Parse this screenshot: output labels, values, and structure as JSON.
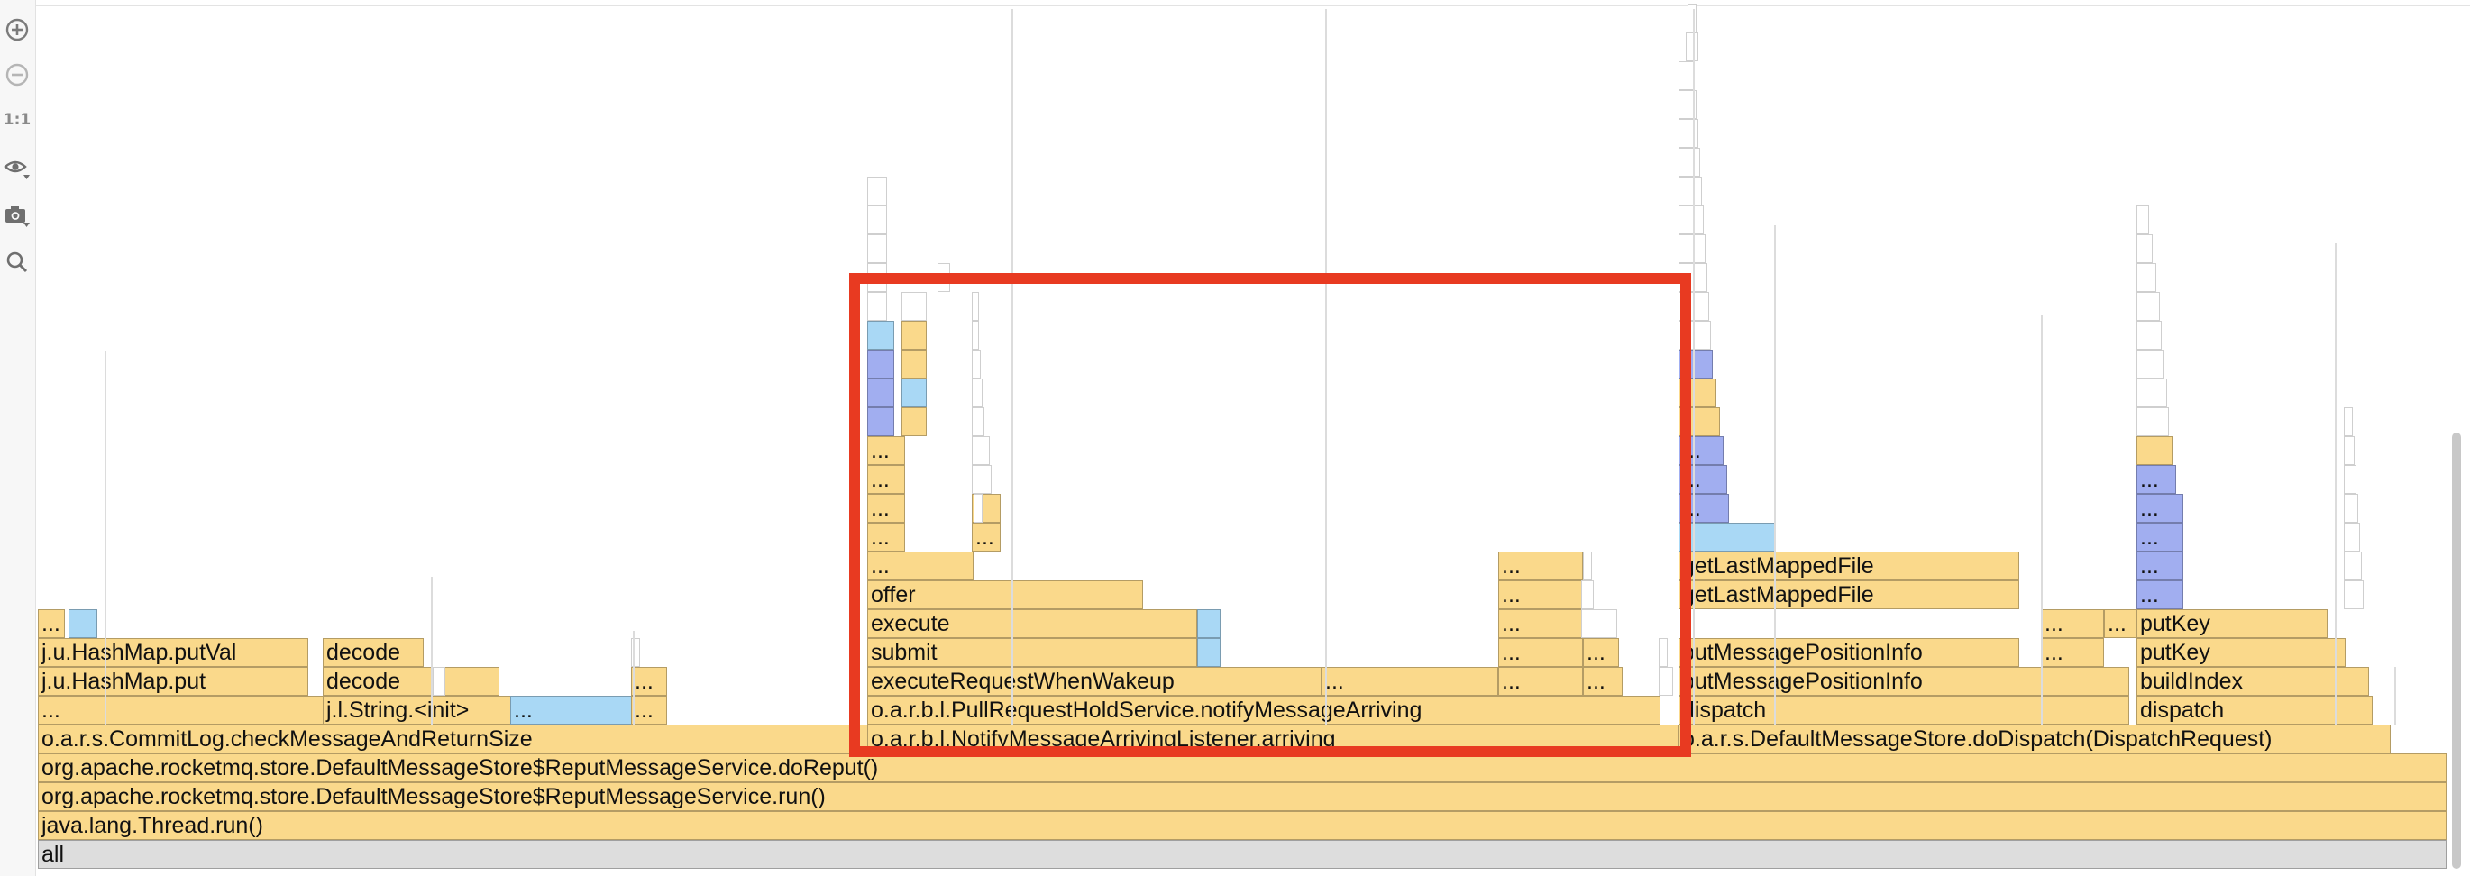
{
  "toolbar": {
    "zoom_in_icon": "zoom-in-icon",
    "zoom_out_icon": "zoom-out-icon",
    "reset_scale_label": "1:1",
    "view_icon": "eye-icon",
    "screenshot_icon": "camera-icon",
    "search_icon": "search-icon"
  },
  "colors": {
    "frame_yellow": "#fad98b",
    "frame_light_blue": "#a9d8f5",
    "frame_blue": "#a1aef0",
    "frame_gray": "#dddddd",
    "frame_empty": "#ffffff",
    "highlight_red": "#e83a21"
  },
  "frames": [
    {
      "label": "all",
      "c": "g"
    },
    {
      "label": "java.lang.Thread.run()",
      "c": "y"
    },
    {
      "label": "org.apache.rocketmq.store.DefaultMessageStore$ReputMessageService.run()",
      "c": "y"
    },
    {
      "label": "org.apache.rocketmq.store.DefaultMessageStore$ReputMessageService.doReput()",
      "c": "y"
    },
    {
      "label": "o.a.r.s.CommitLog.checkMessageAndReturnSize",
      "c": "y"
    },
    {
      "label": "o.a.r.b.l.NotifyMessageArrivingListener.arriving",
      "c": "y"
    },
    {
      "label": "o.a.r.s.DefaultMessageStore.doDispatch(DispatchRequest)",
      "c": "y"
    },
    {
      "label": "...",
      "c": "y"
    },
    {
      "label": "j.l.String.<init>",
      "c": "y"
    },
    {
      "label": "...",
      "c": "b"
    },
    {
      "label": "...",
      "c": "y"
    },
    {
      "label": "o.a.r.b.l.PullRequestHoldService.notifyMessageArriving",
      "c": "y"
    },
    {
      "label": "dispatch",
      "c": "y"
    },
    {
      "label": "dispatch",
      "c": "y"
    },
    {
      "label": "j.u.HashMap.put",
      "c": "y"
    },
    {
      "label": "decode",
      "c": "y"
    },
    {
      "label": "...",
      "c": "y"
    },
    {
      "label": "executeRequestWhenWakeup",
      "c": "y"
    },
    {
      "label": "...",
      "c": "y"
    },
    {
      "label": "...",
      "c": "y"
    },
    {
      "label": "...",
      "c": "y"
    },
    {
      "label": "putMessagePositionInfo",
      "c": "y"
    },
    {
      "label": "buildIndex",
      "c": "y"
    },
    {
      "label": "j.u.HashMap.putVal",
      "c": "y"
    },
    {
      "label": "decode",
      "c": "y"
    },
    {
      "label": "submit",
      "c": "y"
    },
    {
      "label": "",
      "c": "b"
    },
    {
      "label": "...",
      "c": "y"
    },
    {
      "label": "...",
      "c": "y"
    },
    {
      "label": "putMessagePositionInfo",
      "c": "y"
    },
    {
      "label": "...",
      "c": "y"
    },
    {
      "label": "putKey",
      "c": "y"
    },
    {
      "label": "...",
      "c": "y"
    },
    {
      "label": "",
      "c": "b"
    },
    {
      "label": "execute",
      "c": "y"
    },
    {
      "label": "",
      "c": "b"
    },
    {
      "label": "...",
      "c": "y"
    },
    {
      "label": "...",
      "c": "y"
    },
    {
      "label": "...",
      "c": "y"
    },
    {
      "label": "...",
      "c": "y"
    },
    {
      "label": "putKey",
      "c": "y"
    },
    {
      "label": "offer",
      "c": "y"
    },
    {
      "label": "...",
      "c": "y"
    },
    {
      "label": "getLastMappedFile",
      "c": "y"
    },
    {
      "label": "...",
      "c": "v"
    },
    {
      "label": "...",
      "c": "y"
    },
    {
      "label": "...",
      "c": "y"
    },
    {
      "label": "getLastMappedFile",
      "c": "y"
    },
    {
      "label": "...",
      "c": "v"
    },
    {
      "label": "...",
      "c": "y"
    },
    {
      "label": "...",
      "c": "y"
    },
    {
      "label": "",
      "c": "b"
    },
    {
      "label": "...",
      "c": "v"
    },
    {
      "label": "...",
      "c": "y"
    },
    {
      "label": "",
      "c": "y"
    },
    {
      "label": "...",
      "c": "v"
    },
    {
      "label": "...",
      "c": "v"
    },
    {
      "label": "...",
      "c": "y"
    },
    {
      "label": "...",
      "c": "v"
    },
    {
      "label": "...",
      "c": "v"
    },
    {
      "label": "...",
      "c": "y"
    },
    {
      "label": "...",
      "c": "v"
    },
    {
      "label": "",
      "c": "y"
    },
    {
      "label": "",
      "c": "v"
    },
    {
      "label": "",
      "c": "y"
    },
    {
      "label": "",
      "c": "y"
    },
    {
      "label": "",
      "c": "v"
    },
    {
      "label": "",
      "c": "b"
    },
    {
      "label": "",
      "c": "y"
    },
    {
      "label": "",
      "c": "v"
    },
    {
      "label": "",
      "c": "b"
    },
    {
      "label": "",
      "c": "y"
    },
    {
      "label": "",
      "c": "v"
    },
    {
      "label": "",
      "c": "y"
    },
    {
      "label": "",
      "c": "w"
    },
    {
      "label": "",
      "c": "w"
    },
    {
      "label": "",
      "c": "w"
    },
    {
      "label": "",
      "c": "w"
    },
    {
      "label": "",
      "c": "w"
    },
    {
      "label": "",
      "c": "w"
    },
    {
      "label": "",
      "c": "w"
    },
    {
      "label": "",
      "c": "w"
    },
    {
      "label": "",
      "c": "w"
    },
    {
      "label": "",
      "c": "w"
    },
    {
      "label": "",
      "c": "w"
    },
    {
      "label": "",
      "c": "w"
    },
    {
      "label": "",
      "c": "w"
    },
    {
      "label": "",
      "c": "w"
    },
    {
      "label": "",
      "c": "w"
    },
    {
      "label": "",
      "c": "w"
    },
    {
      "label": "",
      "c": "w"
    },
    {
      "label": "",
      "c": "w"
    },
    {
      "label": "",
      "c": "w"
    },
    {
      "label": "",
      "c": "w"
    },
    {
      "label": "",
      "c": "w"
    },
    {
      "label": "",
      "c": "w"
    },
    {
      "label": "",
      "c": "w"
    },
    {
      "label": "",
      "c": "w"
    },
    {
      "label": "",
      "c": "w"
    },
    {
      "label": "",
      "c": "w"
    },
    {
      "label": "",
      "c": "w"
    },
    {
      "label": "",
      "c": "w"
    },
    {
      "label": "",
      "c": "w"
    },
    {
      "label": "",
      "c": "w"
    },
    {
      "label": "",
      "c": "w"
    },
    {
      "label": "",
      "c": "w"
    },
    {
      "label": "",
      "c": "w"
    },
    {
      "label": "",
      "c": "w"
    },
    {
      "label": "",
      "c": "w"
    },
    {
      "label": "",
      "c": "w"
    },
    {
      "label": "",
      "c": "w"
    },
    {
      "label": "",
      "c": "w"
    },
    {
      "label": "",
      "c": "w"
    },
    {
      "label": "",
      "c": "w"
    },
    {
      "label": "",
      "c": "w"
    },
    {
      "label": "",
      "c": "w"
    },
    {
      "label": "",
      "c": "w"
    },
    {
      "label": "",
      "c": "w"
    },
    {
      "label": "",
      "c": "w"
    },
    {
      "label": "",
      "c": "w"
    },
    {
      "label": "",
      "c": "w"
    },
    {
      "label": "",
      "c": "w"
    },
    {
      "label": "",
      "c": "w"
    },
    {
      "label": "",
      "c": "w"
    },
    {
      "label": "",
      "c": "w"
    },
    {
      "label": "",
      "c": "w"
    }
  ]
}
